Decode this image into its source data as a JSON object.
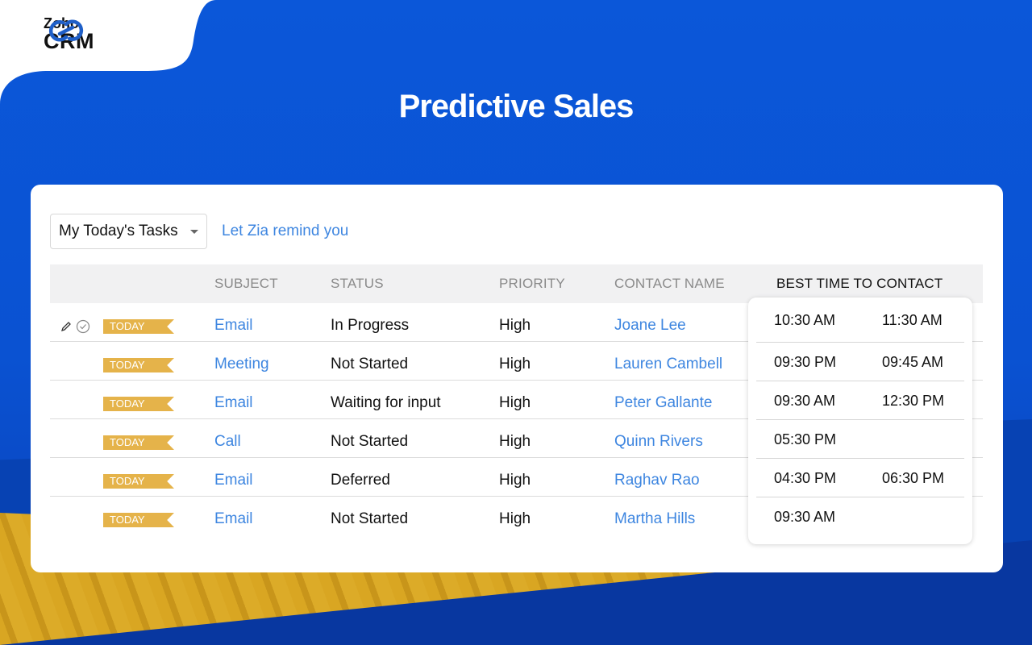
{
  "brand": {
    "name_small": "Zoho",
    "name_large": "CRM"
  },
  "page_title": "Predictive Sales",
  "toolbar": {
    "view_selected": "My Today's Tasks",
    "zia_link": "Let Zia remind you"
  },
  "columns": {
    "subject": "SUBJECT",
    "status": "STATUS",
    "priority": "PRIORITY",
    "contact": "CONTACT NAME",
    "best_time": "BEST TIME TO CONTACT"
  },
  "badge_label": "TODAY",
  "row_icons": [
    "pencil-icon",
    "check-circle-icon"
  ],
  "rows": [
    {
      "subject": "Email",
      "status": "In Progress",
      "priority": "High",
      "contact": "Joane Lee",
      "time1": "10:30 AM",
      "time2": "11:30 AM"
    },
    {
      "subject": "Meeting",
      "status": "Not Started",
      "priority": "High",
      "contact": "Lauren Cambell",
      "time1": "09:30 PM",
      "time2": "09:45 AM"
    },
    {
      "subject": "Email",
      "status": "Waiting for input",
      "priority": "High",
      "contact": "Peter Gallante",
      "time1": "09:30 AM",
      "time2": "12:30 PM"
    },
    {
      "subject": "Call",
      "status": "Not Started",
      "priority": "High",
      "contact": "Quinn Rivers",
      "time1": "05:30 PM",
      "time2": ""
    },
    {
      "subject": "Email",
      "status": "Deferred",
      "priority": "High",
      "contact": "Raghav Rao",
      "time1": "04:30 PM",
      "time2": "06:30 PM"
    },
    {
      "subject": "Email",
      "status": "Not Started",
      "priority": "High",
      "contact": "Martha Hills",
      "time1": "09:30 AM",
      "time2": ""
    }
  ],
  "colors": {
    "brand_blue": "#0b57d9",
    "link_blue": "#3e86e0",
    "badge_gold": "#e5b34a",
    "accent_yellow": "#d9a622"
  }
}
